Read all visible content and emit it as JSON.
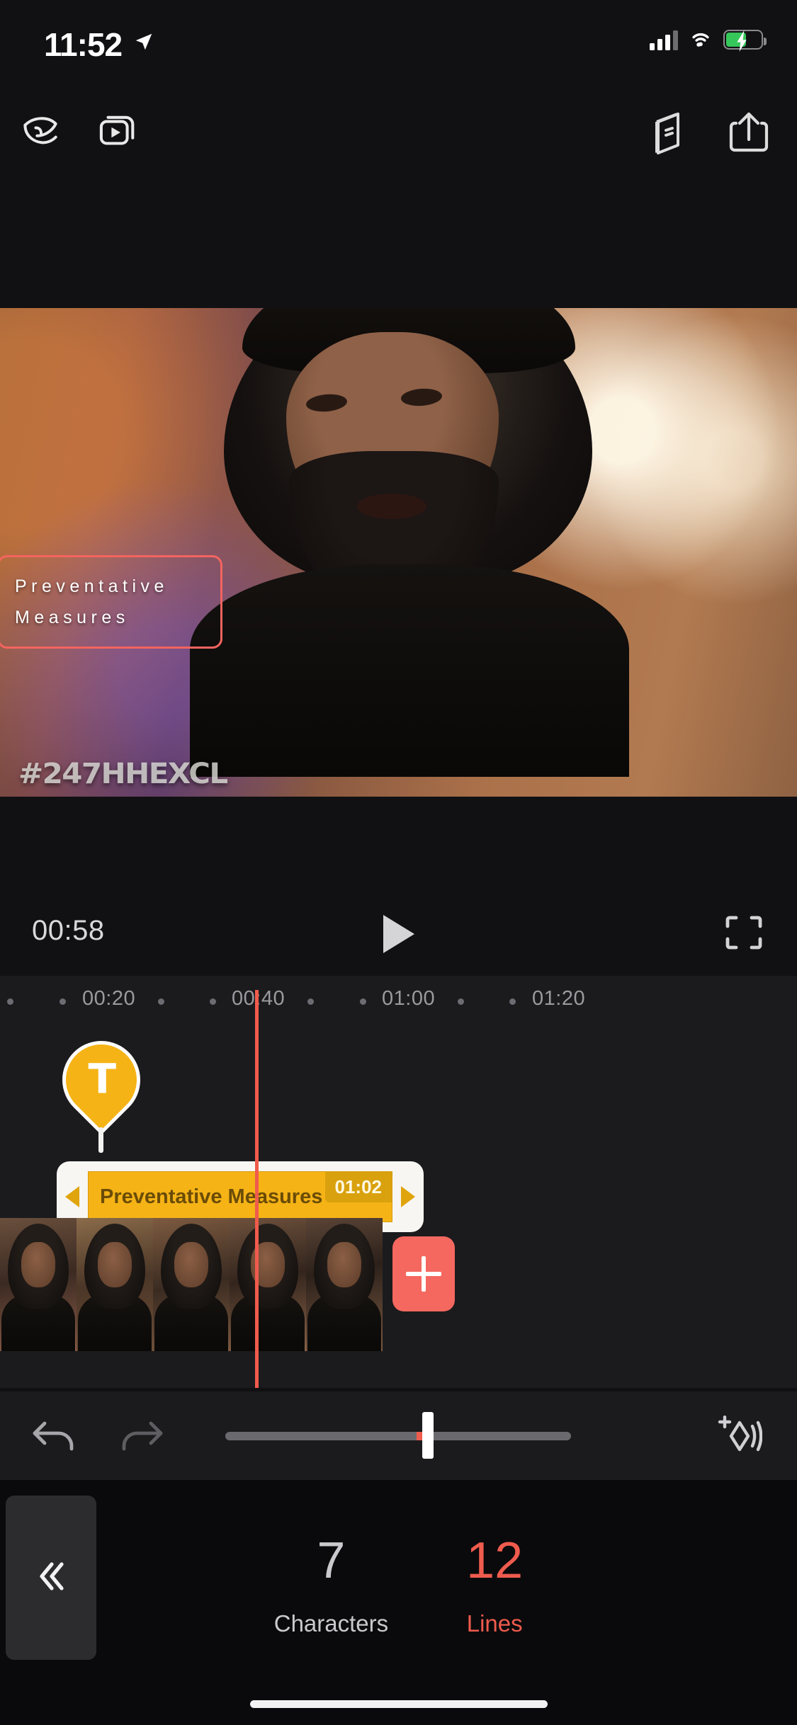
{
  "status_bar": {
    "time": "11:52",
    "location_icon": "location-arrow-icon",
    "cellular_icon": "cellular-bars-icon",
    "wifi_icon": "wifi-icon",
    "battery_icon": "battery-charging-icon",
    "battery_color": "#35c759"
  },
  "toolbar": {
    "logo_icon": "app-logo-icon",
    "videos_icon": "video-projects-icon",
    "tutorial_icon": "book-tutorial-icon",
    "share_icon": "share-export-icon"
  },
  "preview": {
    "overlay_line_1": "Preventative",
    "overlay_line_2": "Measures",
    "overlay_border_color": "#f4645f",
    "watermark": "#247HHEXCL"
  },
  "playback": {
    "current_time": "00:58",
    "play_icon": "play-icon",
    "fullscreen_icon": "fullscreen-icon"
  },
  "ruler": {
    "ticks": [
      "00:20",
      "00:40",
      "01:00",
      "01:20"
    ]
  },
  "timeline": {
    "marker_letter": "T",
    "marker_color": "#f5b316",
    "clip_label": "Preventative  Measures",
    "clip_duration": "01:02",
    "trim_left_icon": "trim-left-handle-icon",
    "trim_right_icon": "trim-right-handle-icon",
    "add_clip_icon": "plus-icon",
    "add_clip_color": "#f4685f",
    "playhead_color": "#ef5b4d"
  },
  "tools": {
    "undo_icon": "undo-arrow-icon",
    "redo_icon": "redo-arrow-icon",
    "zoom_slider_label": "timeline-zoom-slider",
    "add_sound_icon": "add-sound-icon"
  },
  "bottom_panel": {
    "collapse_icon": "chevron-double-left-icon",
    "stats": [
      {
        "value": "7",
        "label": "Characters",
        "color": "#c9c9ce"
      },
      {
        "value": "12",
        "label": "Lines",
        "color": "#ef5b4d"
      }
    ]
  }
}
